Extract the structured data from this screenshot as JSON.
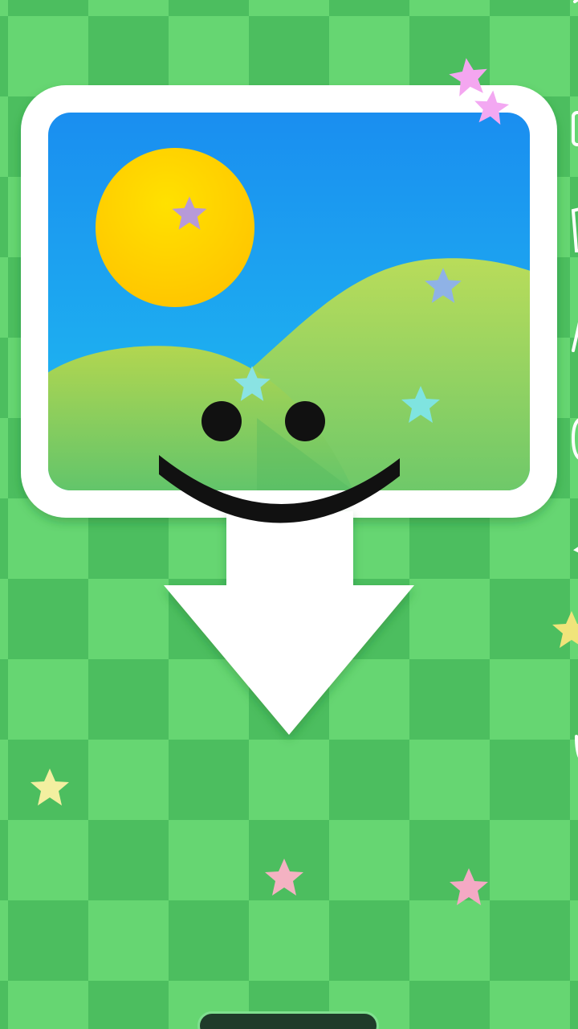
{
  "app": {
    "screen": "save-image-splash",
    "action": "download-image"
  },
  "icons": [
    "picture-frame-icon",
    "sun-icon",
    "hills-icon",
    "smiley-face-icon",
    "download-arrow-icon",
    "star-icon"
  ],
  "colors": {
    "background_light": "#6fe07a",
    "background_dark": "#4cbe5f",
    "frame": "#ffffff",
    "sky_top": "#1a8ef0",
    "sky_bottom": "#1fbef0",
    "sun": "#ffd500",
    "hill": "#a8d44e",
    "face": "#111111",
    "arrow": "#ffffff"
  }
}
